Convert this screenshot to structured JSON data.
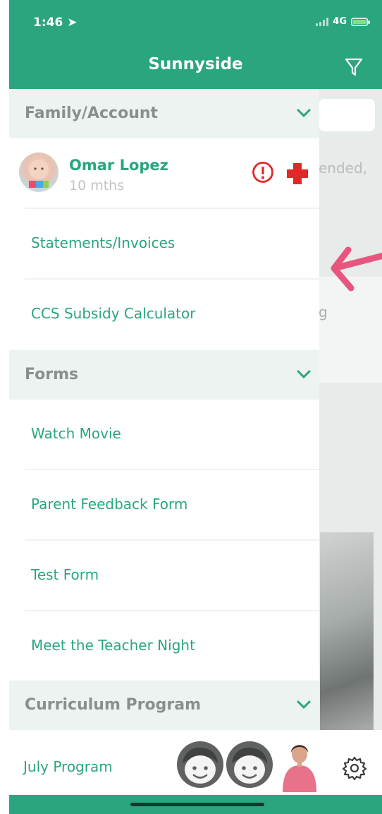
{
  "status_bar": {
    "time": "1:46",
    "network": "4G"
  },
  "header": {
    "title": "Sunnyside"
  },
  "drawer": {
    "family_section": {
      "title": "Family/Account"
    },
    "child": {
      "name": "Omar Lopez",
      "age": "10 mths"
    },
    "family_items": [
      {
        "label": "Statements/Invoices"
      },
      {
        "label": "CCS Subsidy Calculator"
      }
    ],
    "forms_section": {
      "title": "Forms"
    },
    "forms_items": [
      {
        "label": "Watch Movie"
      },
      {
        "label": "Parent Feedback Form"
      },
      {
        "label": "Test Form"
      },
      {
        "label": "Meet the Teacher Night"
      }
    ],
    "curriculum_section": {
      "title": "Curriculum Program"
    },
    "curriculum_items": [
      {
        "label": "July Program"
      }
    ]
  },
  "background": {
    "card_text": "ended,",
    "side_text": "g"
  },
  "colors": {
    "brand": "#2aa57f",
    "section_bg": "#edf3f1",
    "alert": "#e32727",
    "annotation_arrow": "#e8557f"
  },
  "icons": [
    "filter-icon",
    "chevron-down-icon",
    "alert-icon",
    "medical-cross-icon",
    "gear-icon"
  ]
}
